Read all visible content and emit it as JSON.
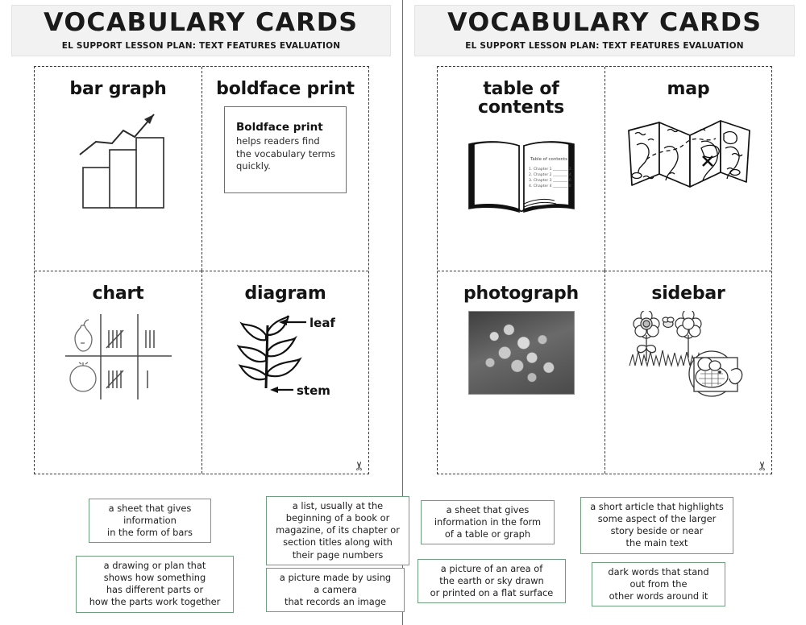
{
  "header": {
    "title": "VOCABULARY CARDS",
    "subtitle": "EL SUPPORT LESSON PLAN: TEXT FEATURES EVALUATION"
  },
  "pages": [
    {
      "id": "left-page",
      "cards": [
        {
          "id": "bar-graph",
          "title": "bar graph",
          "art": "bar-chart-arrow"
        },
        {
          "id": "boldface-print",
          "title": "boldface print",
          "art": "boldface-demo-box",
          "demo": {
            "bold_lead": "Boldface print",
            "body": "helps readers find\nthe vocabulary terms\nquickly."
          }
        },
        {
          "id": "chart",
          "title": "chart",
          "art": "tally-chart"
        },
        {
          "id": "diagram",
          "title": "diagram",
          "art": "plant-diagram",
          "labels": {
            "leaf": "leaf",
            "stem": "stem"
          }
        }
      ],
      "definitions": [
        {
          "id": "def-bar-graph",
          "text": "a sheet that gives\ninformation\nin the form of bars"
        },
        {
          "id": "def-table-of-contents",
          "text": "a list, usually at the\nbeginning of a book or\nmagazine, of its chapter or\nsection titles along with\ntheir page numbers"
        },
        {
          "id": "def-diagram",
          "text": "a drawing or plan that\nshows how something\nhas different parts or\nhow the parts work together"
        },
        {
          "id": "def-photograph",
          "text": "a picture made by using\na camera\nthat records an image"
        }
      ]
    },
    {
      "id": "right-page",
      "cards": [
        {
          "id": "table-of-contents",
          "title": "table of contents",
          "art": "open-book",
          "book": {
            "heading": "Table of contents",
            "lines": [
              "1. Chapter 1",
              "2. Chapter 2",
              "3. Chapter 3",
              "4. Chapter 4"
            ]
          }
        },
        {
          "id": "map",
          "title": "map",
          "art": "folded-map"
        },
        {
          "id": "photograph",
          "title": "photograph",
          "art": "clover-photo"
        },
        {
          "id": "sidebar",
          "title": "sidebar",
          "art": "flowers-bee-magnifier"
        }
      ],
      "definitions": [
        {
          "id": "def-chart",
          "text": "a sheet that gives\ninformation in the form\nof a table or graph"
        },
        {
          "id": "def-sidebar",
          "text": "a short article that highlights\nsome aspect of the larger\nstory beside or near\nthe main text"
        },
        {
          "id": "def-map",
          "text": "a picture of an area of\nthe earth or sky drawn\nor printed on a flat surface"
        },
        {
          "id": "def-boldface-print",
          "text": "dark words that stand\nout from the\nother words around it"
        }
      ]
    }
  ],
  "cut_marker": {
    "glyph": "✂",
    "label": "scissors-cut-line"
  },
  "colors": {
    "header_band": "#f2f2f2",
    "ink": "#141414",
    "definition_border": "#6d9e7d",
    "cut_line": "#3a3a3a"
  }
}
